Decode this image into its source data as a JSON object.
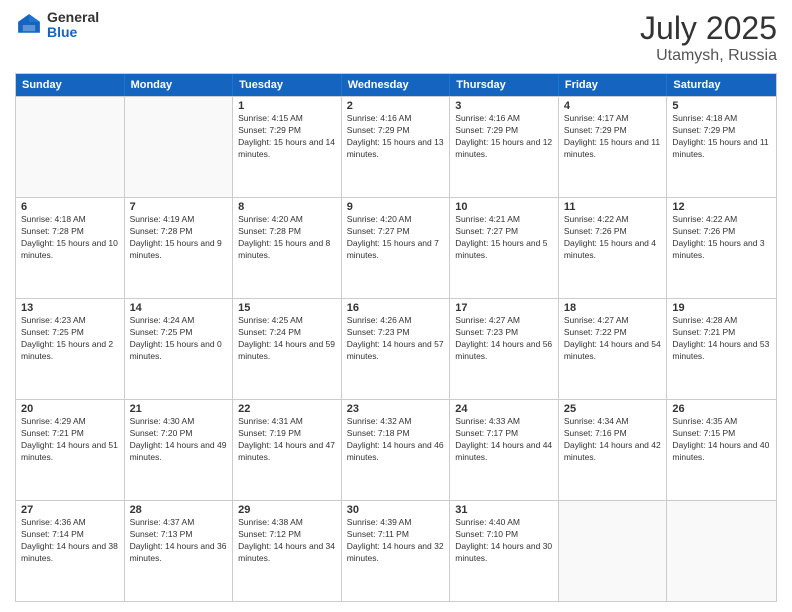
{
  "header": {
    "logo_general": "General",
    "logo_blue": "Blue",
    "month": "July 2025",
    "location": "Utamysh, Russia"
  },
  "days_of_week": [
    "Sunday",
    "Monday",
    "Tuesday",
    "Wednesday",
    "Thursday",
    "Friday",
    "Saturday"
  ],
  "weeks": [
    [
      {
        "day": "",
        "info": ""
      },
      {
        "day": "",
        "info": ""
      },
      {
        "day": "1",
        "info": "Sunrise: 4:15 AM\nSunset: 7:29 PM\nDaylight: 15 hours and 14 minutes."
      },
      {
        "day": "2",
        "info": "Sunrise: 4:16 AM\nSunset: 7:29 PM\nDaylight: 15 hours and 13 minutes."
      },
      {
        "day": "3",
        "info": "Sunrise: 4:16 AM\nSunset: 7:29 PM\nDaylight: 15 hours and 12 minutes."
      },
      {
        "day": "4",
        "info": "Sunrise: 4:17 AM\nSunset: 7:29 PM\nDaylight: 15 hours and 11 minutes."
      },
      {
        "day": "5",
        "info": "Sunrise: 4:18 AM\nSunset: 7:29 PM\nDaylight: 15 hours and 11 minutes."
      }
    ],
    [
      {
        "day": "6",
        "info": "Sunrise: 4:18 AM\nSunset: 7:28 PM\nDaylight: 15 hours and 10 minutes."
      },
      {
        "day": "7",
        "info": "Sunrise: 4:19 AM\nSunset: 7:28 PM\nDaylight: 15 hours and 9 minutes."
      },
      {
        "day": "8",
        "info": "Sunrise: 4:20 AM\nSunset: 7:28 PM\nDaylight: 15 hours and 8 minutes."
      },
      {
        "day": "9",
        "info": "Sunrise: 4:20 AM\nSunset: 7:27 PM\nDaylight: 15 hours and 7 minutes."
      },
      {
        "day": "10",
        "info": "Sunrise: 4:21 AM\nSunset: 7:27 PM\nDaylight: 15 hours and 5 minutes."
      },
      {
        "day": "11",
        "info": "Sunrise: 4:22 AM\nSunset: 7:26 PM\nDaylight: 15 hours and 4 minutes."
      },
      {
        "day": "12",
        "info": "Sunrise: 4:22 AM\nSunset: 7:26 PM\nDaylight: 15 hours and 3 minutes."
      }
    ],
    [
      {
        "day": "13",
        "info": "Sunrise: 4:23 AM\nSunset: 7:25 PM\nDaylight: 15 hours and 2 minutes."
      },
      {
        "day": "14",
        "info": "Sunrise: 4:24 AM\nSunset: 7:25 PM\nDaylight: 15 hours and 0 minutes."
      },
      {
        "day": "15",
        "info": "Sunrise: 4:25 AM\nSunset: 7:24 PM\nDaylight: 14 hours and 59 minutes."
      },
      {
        "day": "16",
        "info": "Sunrise: 4:26 AM\nSunset: 7:23 PM\nDaylight: 14 hours and 57 minutes."
      },
      {
        "day": "17",
        "info": "Sunrise: 4:27 AM\nSunset: 7:23 PM\nDaylight: 14 hours and 56 minutes."
      },
      {
        "day": "18",
        "info": "Sunrise: 4:27 AM\nSunset: 7:22 PM\nDaylight: 14 hours and 54 minutes."
      },
      {
        "day": "19",
        "info": "Sunrise: 4:28 AM\nSunset: 7:21 PM\nDaylight: 14 hours and 53 minutes."
      }
    ],
    [
      {
        "day": "20",
        "info": "Sunrise: 4:29 AM\nSunset: 7:21 PM\nDaylight: 14 hours and 51 minutes."
      },
      {
        "day": "21",
        "info": "Sunrise: 4:30 AM\nSunset: 7:20 PM\nDaylight: 14 hours and 49 minutes."
      },
      {
        "day": "22",
        "info": "Sunrise: 4:31 AM\nSunset: 7:19 PM\nDaylight: 14 hours and 47 minutes."
      },
      {
        "day": "23",
        "info": "Sunrise: 4:32 AM\nSunset: 7:18 PM\nDaylight: 14 hours and 46 minutes."
      },
      {
        "day": "24",
        "info": "Sunrise: 4:33 AM\nSunset: 7:17 PM\nDaylight: 14 hours and 44 minutes."
      },
      {
        "day": "25",
        "info": "Sunrise: 4:34 AM\nSunset: 7:16 PM\nDaylight: 14 hours and 42 minutes."
      },
      {
        "day": "26",
        "info": "Sunrise: 4:35 AM\nSunset: 7:15 PM\nDaylight: 14 hours and 40 minutes."
      }
    ],
    [
      {
        "day": "27",
        "info": "Sunrise: 4:36 AM\nSunset: 7:14 PM\nDaylight: 14 hours and 38 minutes."
      },
      {
        "day": "28",
        "info": "Sunrise: 4:37 AM\nSunset: 7:13 PM\nDaylight: 14 hours and 36 minutes."
      },
      {
        "day": "29",
        "info": "Sunrise: 4:38 AM\nSunset: 7:12 PM\nDaylight: 14 hours and 34 minutes."
      },
      {
        "day": "30",
        "info": "Sunrise: 4:39 AM\nSunset: 7:11 PM\nDaylight: 14 hours and 32 minutes."
      },
      {
        "day": "31",
        "info": "Sunrise: 4:40 AM\nSunset: 7:10 PM\nDaylight: 14 hours and 30 minutes."
      },
      {
        "day": "",
        "info": ""
      },
      {
        "day": "",
        "info": ""
      }
    ]
  ]
}
